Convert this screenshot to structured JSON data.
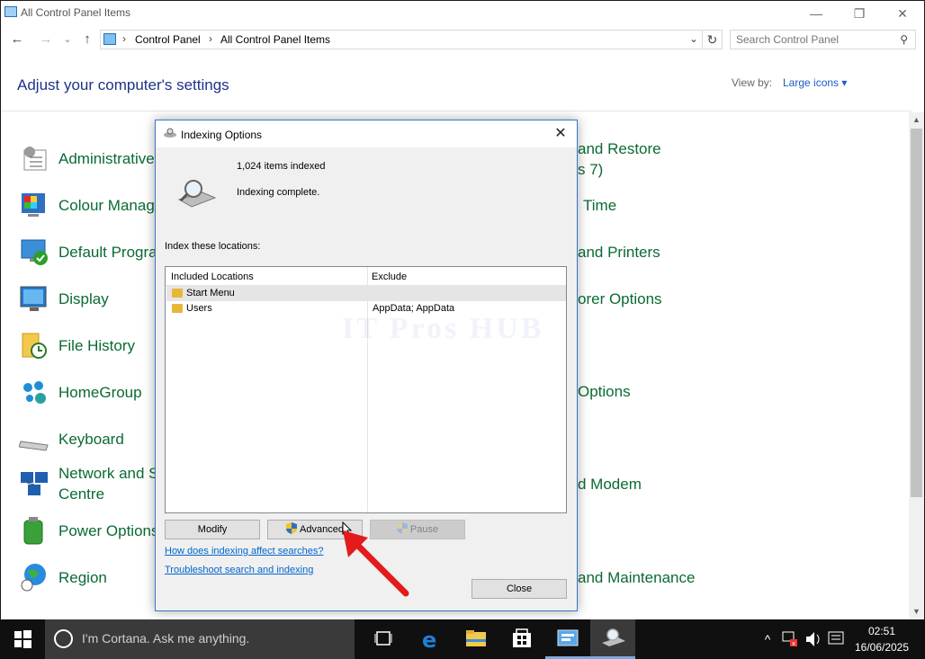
{
  "window": {
    "title": "All Control Panel Items",
    "minimize": "—",
    "maximize": "❐",
    "close": "✕"
  },
  "nav": {
    "back": "←",
    "forward": "→",
    "recent": "⌄",
    "up": "↑",
    "breadcrumb": [
      "Control Panel",
      "All Control Panel Items"
    ],
    "refresh": "↻",
    "search_placeholder": "Search Control Panel"
  },
  "header": {
    "title": "Adjust your computer's settings",
    "view_by_label": "View by:",
    "view_by_value": "Large icons ▾"
  },
  "items_left": [
    {
      "label": "Administrative",
      "icon": "admin-tools-icon"
    },
    {
      "label": "Colour Manage",
      "icon": "colour-management-icon"
    },
    {
      "label": "Default Progra",
      "icon": "default-programs-icon"
    },
    {
      "label": "Display",
      "icon": "display-icon"
    },
    {
      "label": "File History",
      "icon": "file-history-icon"
    },
    {
      "label": "HomeGroup",
      "icon": "homegroup-icon"
    },
    {
      "label": "Keyboard",
      "icon": "keyboard-icon"
    },
    {
      "label": "Network and Sh",
      "label2": "Centre",
      "icon": "network-icon"
    },
    {
      "label": "Power Options",
      "icon": "power-options-icon"
    },
    {
      "label": "Region",
      "icon": "region-icon"
    }
  ],
  "items_right": [
    {
      "label": "and Restore",
      "label2": "s 7)"
    },
    {
      "label": "Time"
    },
    {
      "label": "and Printers"
    },
    {
      "label": "orer Options"
    },
    {
      "label": "Options"
    },
    {
      "label": "d Modem"
    },
    {
      "label": "and Maintenance"
    }
  ],
  "dialog": {
    "title": "Indexing Options",
    "close": "✕",
    "items_indexed": "1,024 items indexed",
    "status": "Indexing complete.",
    "locations_label": "Index these locations:",
    "columns": [
      "Included Locations",
      "Exclude"
    ],
    "rows": [
      {
        "name": "Start Menu",
        "exclude": "",
        "selected": true
      },
      {
        "name": "Users",
        "exclude": "AppData; AppData",
        "selected": false
      }
    ],
    "watermark": "IT Pros HUB",
    "buttons": {
      "modify": "Modify",
      "advanced": "Advanced",
      "pause": "Pause",
      "close": "Close"
    },
    "links": {
      "affect": "How does indexing affect searches?",
      "troubleshoot": "Troubleshoot search and indexing"
    }
  },
  "taskbar": {
    "cortana_text": "I'm Cortana. Ask me anything.",
    "time": "02:51",
    "date": "16/06/2025"
  },
  "colors": {
    "link_green": "#0b6a33",
    "heading_blue": "#1e3287",
    "accent": "#3a77c8",
    "arrow_red": "#e31b1b"
  }
}
